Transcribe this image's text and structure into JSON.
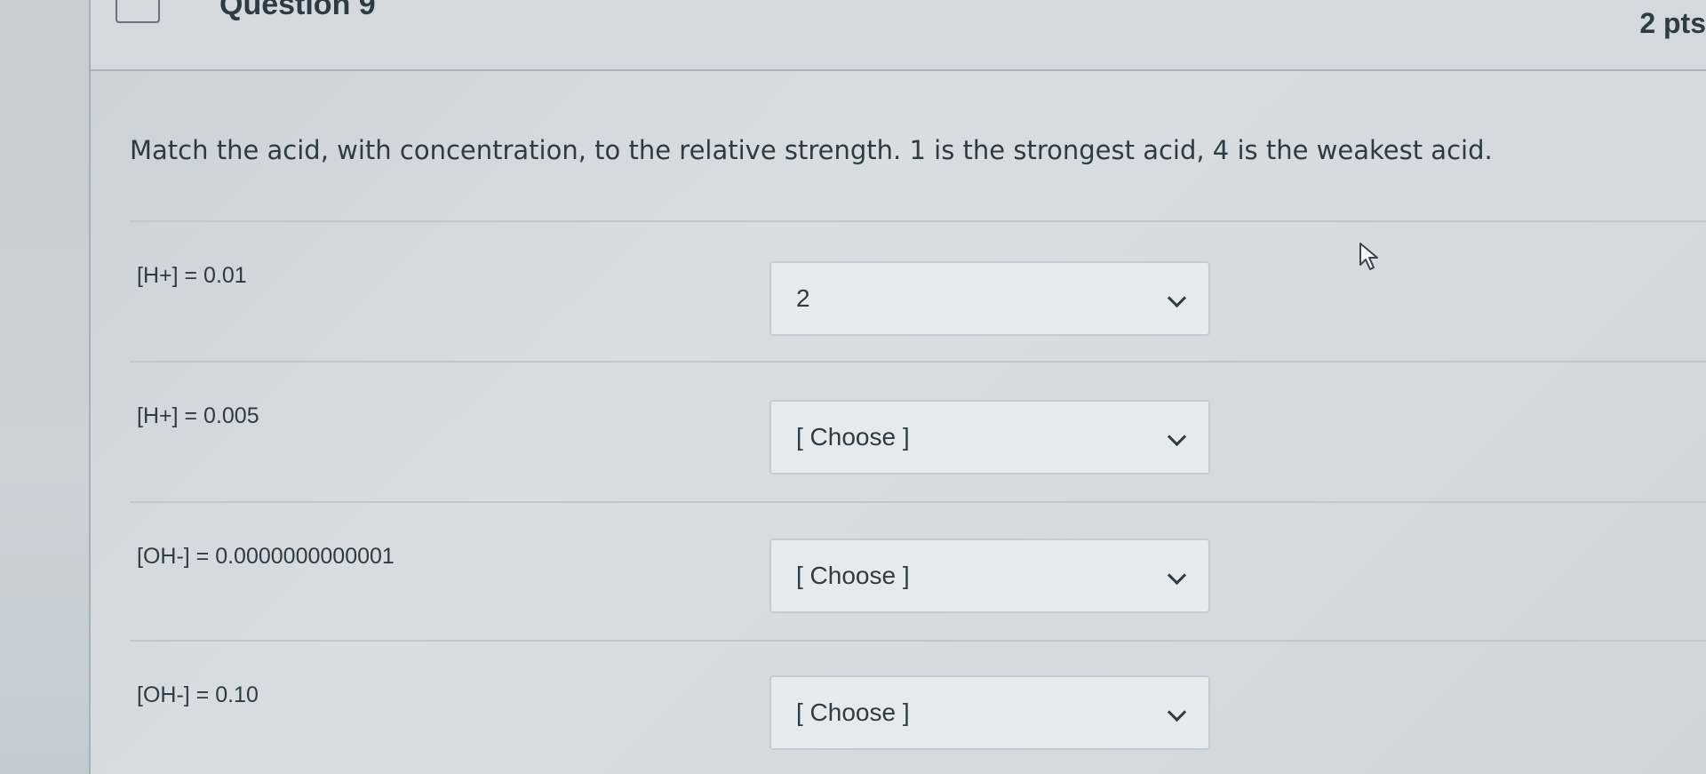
{
  "question": {
    "title": "Question 9",
    "points": "2 pts",
    "prompt": "Match the acid, with concentration, to the relative strength. 1 is the strongest acid, 4 is the weakest acid."
  },
  "rows": [
    {
      "label": "[H+] = 0.01",
      "selected": "2"
    },
    {
      "label": "[H+] = 0.005",
      "selected": "[ Choose ]"
    },
    {
      "label": "[OH-] = 0.0000000000001",
      "selected": "[ Choose ]"
    },
    {
      "label": "[OH-] = 0.10",
      "selected": "[ Choose ]"
    }
  ],
  "icons": {
    "dropdown": "chevron-down-icon",
    "cursor": "mouse-pointer-icon",
    "flag": "bookmark-flag-icon"
  }
}
